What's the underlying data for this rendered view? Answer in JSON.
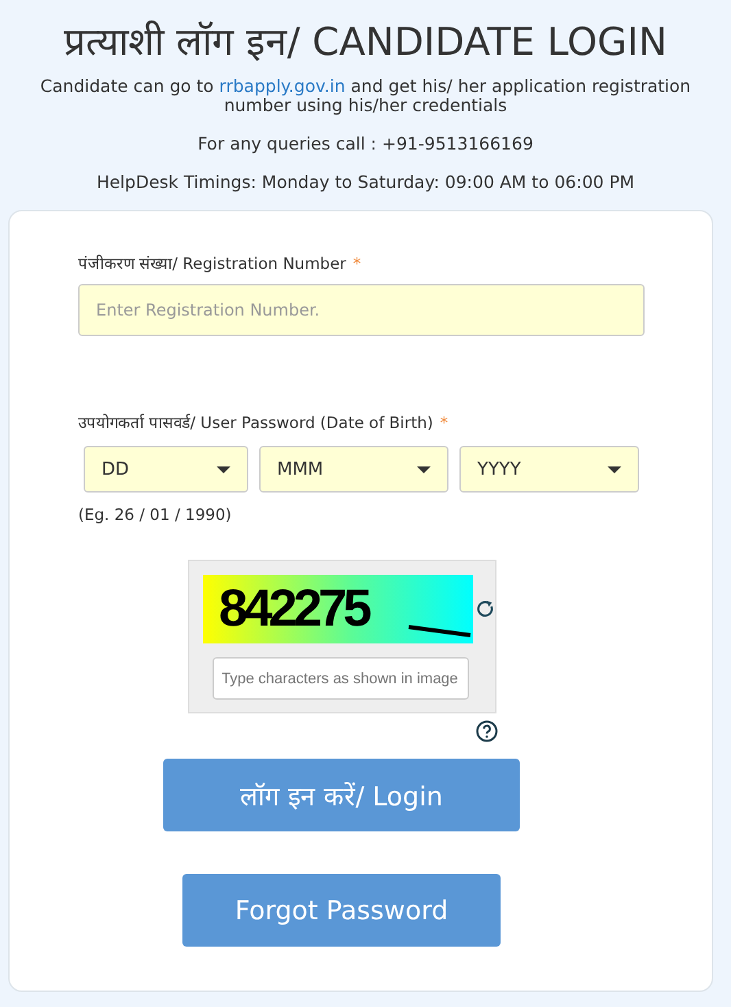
{
  "heading": "प्रत्याशी लॉग इन/ CANDIDATE LOGIN",
  "intro": {
    "before": "Candidate can go to ",
    "link": "rrbapply.gov.in",
    "after": " and get his/ her application registration number using his/her credentials"
  },
  "queries": "For any queries call : +91-9513166169",
  "timings": "HelpDesk Timings: Monday to Saturday: 09:00 AM to 06:00 PM",
  "registration": {
    "label": "पंजीकरण संख्या/ Registration Number",
    "required_mark": "*",
    "placeholder": "Enter Registration Number."
  },
  "password": {
    "label": "उपयोगकर्ता पासवर्ड/ User Password (Date of Birth)",
    "required_mark": "*",
    "selects": [
      {
        "value": "DD"
      },
      {
        "value": "MMM"
      },
      {
        "value": "YYYY"
      }
    ],
    "hint": "(Eg. 26 / 01 / 1990)"
  },
  "captcha": {
    "code": "842275",
    "placeholder": "Type characters as shown in image"
  },
  "buttons": [
    {
      "label": "लॉग इन करें/ Login"
    },
    {
      "label": "Forgot Password"
    }
  ]
}
